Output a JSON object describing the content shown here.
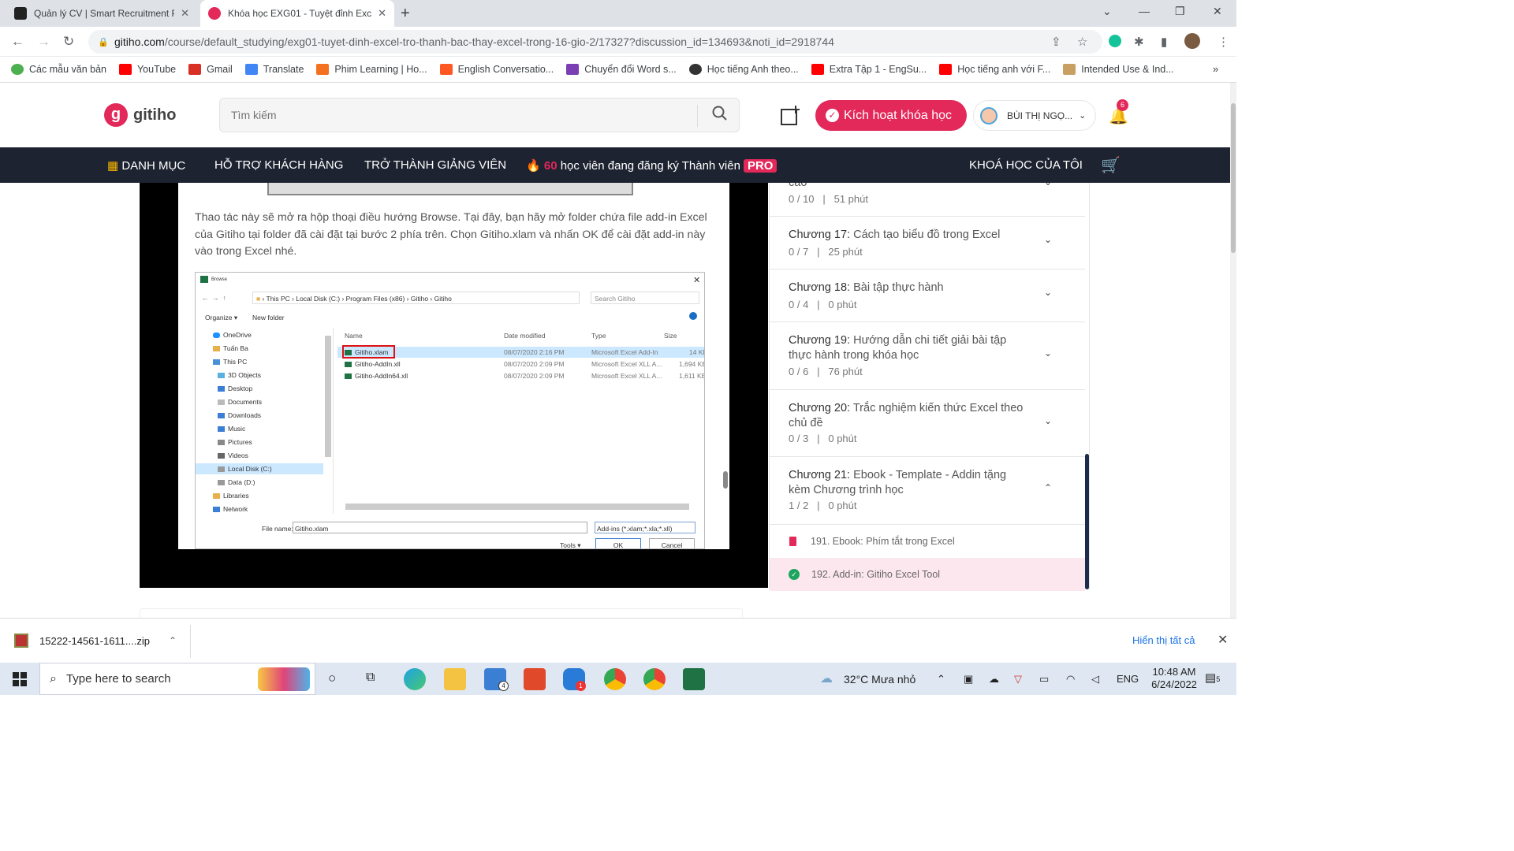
{
  "browser": {
    "tabs": [
      {
        "title": "Quản lý CV | Smart Recruitment P"
      },
      {
        "title": "Khóa học EXG01 - Tuyệt đỉnh Exc"
      }
    ],
    "url_host": "gitiho.com",
    "url_path": "/course/default_studying/exg01-tuyet-dinh-excel-tro-thanh-bac-thay-excel-trong-16-gio-2/17327?discussion_id=134693&noti_id=2918744",
    "bookmarks": [
      {
        "label": "Các mẫu văn bản",
        "color": "#4caf50"
      },
      {
        "label": "YouTube",
        "color": "#ff0000"
      },
      {
        "label": "Gmail",
        "color": "#d93025"
      },
      {
        "label": "Translate",
        "color": "#4285f4"
      },
      {
        "label": "Phim Learning | Ho...",
        "color": "#f4711f"
      },
      {
        "label": "English Conversatio...",
        "color": "#ff5722"
      },
      {
        "label": "Chuyển đổi Word s...",
        "color": "#7b3fb3"
      },
      {
        "label": "Học tiếng Anh theo...",
        "color": "#333333"
      },
      {
        "label": "Extra Tập 1 - EngSu...",
        "color": "#ff0000"
      },
      {
        "label": "Học tiếng anh với F...",
        "color": "#ff0000"
      },
      {
        "label": "Intended Use & Ind...",
        "color": "#c9a063"
      }
    ]
  },
  "header": {
    "logo_text": "gitiho",
    "search_placeholder": "Tìm kiếm",
    "activate_label": "Kích hoạt khóa học",
    "user_name": "BÙI THỊ NGỌ...",
    "notification_count": "6"
  },
  "nav": {
    "category": "DANH MỤC",
    "support": "HỖ TRỢ KHÁCH HÀNG",
    "teacher": "TRỞ THÀNH GIẢNG VIÊN",
    "promo_count": "60",
    "promo_text": "học viên đang đăng ký Thành viên",
    "promo_badge": "PRO",
    "my_courses": "KHOÁ HỌC CỦA TÔI"
  },
  "article": {
    "paragraph": "Thao tác này sẽ mở ra hộp thoại điều hướng Browse. Tại đây, bạn hãy mở folder chứa file add-in Excel của Gitiho tại folder đã cài đặt tại bước 2 phía trên. Chọn Gitiho.xlam và nhấn OK để cài đặt add-in này vào trong Excel nhé.",
    "dialog": {
      "title": "Browse",
      "path": [
        "This PC",
        "Local Disk (C:)",
        "Program Files (x86)",
        "Gitiho",
        "Gitiho"
      ],
      "search_placeholder": "Search Gitiho",
      "organize": "Organize ▾",
      "new_folder": "New folder",
      "tree": [
        "OneDrive",
        "Tuấn Ba",
        "This PC",
        "3D Objects",
        "Desktop",
        "Documents",
        "Downloads",
        "Music",
        "Pictures",
        "Videos",
        "Local Disk (C:)",
        "Data (D:)",
        "Libraries",
        "Network"
      ],
      "columns": [
        "Name",
        "Date modified",
        "Type",
        "Size"
      ],
      "files": [
        {
          "name": "Gitiho.xlam",
          "date": "08/07/2020 2:16 PM",
          "type": "Microsoft Excel Add-In",
          "size": "14 KB"
        },
        {
          "name": "Gitiho-AddIn.xll",
          "date": "08/07/2020 2:09 PM",
          "type": "Microsoft Excel XLL A...",
          "size": "1,694 KB"
        },
        {
          "name": "Gitiho-AddIn64.xll",
          "date": "08/07/2020 2:09 PM",
          "type": "Microsoft Excel XLL A...",
          "size": "1,611 KB"
        }
      ],
      "file_name_label": "File name:",
      "file_name_value": "Gitiho.xlam",
      "filter": "Add-ins (*.xlam;*.xla;*.xll)",
      "tools": "Tools ▾",
      "ok": "OK",
      "cancel": "Cancel"
    }
  },
  "sidebar": {
    "partial": {
      "title": "cao",
      "progress": "0 / 10",
      "duration": "51 phút"
    },
    "chapters": [
      {
        "label": "Chương 17:",
        "title": "Cách tạo biểu đồ trong Excel",
        "progress": "0 / 7",
        "duration": "25 phút"
      },
      {
        "label": "Chương 18:",
        "title": "Bài tập thực hành",
        "progress": "0 / 4",
        "duration": "0 phút"
      },
      {
        "label": "Chương 19:",
        "title": "Hướng dẫn chi tiết giải bài tập thực hành trong khóa học",
        "progress": "0 / 6",
        "duration": "76 phút"
      },
      {
        "label": "Chương 20:",
        "title": "Trắc nghiệm kiến thức Excel theo chủ đề",
        "progress": "0 / 3",
        "duration": "0 phút"
      },
      {
        "label": "Chương 21:",
        "title": "Ebook - Template - Addin tặng kèm Chương trình học",
        "progress": "1 / 2",
        "duration": "0 phút"
      }
    ],
    "lessons": [
      {
        "label": "191. Ebook: Phím tắt trong Excel"
      },
      {
        "label": "192. Add-in: Gitiho Excel Tool"
      }
    ]
  },
  "downloads": {
    "file": "15222-14561-1611....zip",
    "show_all": "Hiển thị tất cả"
  },
  "taskbar": {
    "search_placeholder": "Type here to search",
    "weather": "32°C  Mưa nhỏ",
    "lang": "ENG",
    "time": "10:48 AM",
    "date": "6/24/2022",
    "mail_badge": "4",
    "zalo_badge": "1",
    "notif_count": "5"
  }
}
